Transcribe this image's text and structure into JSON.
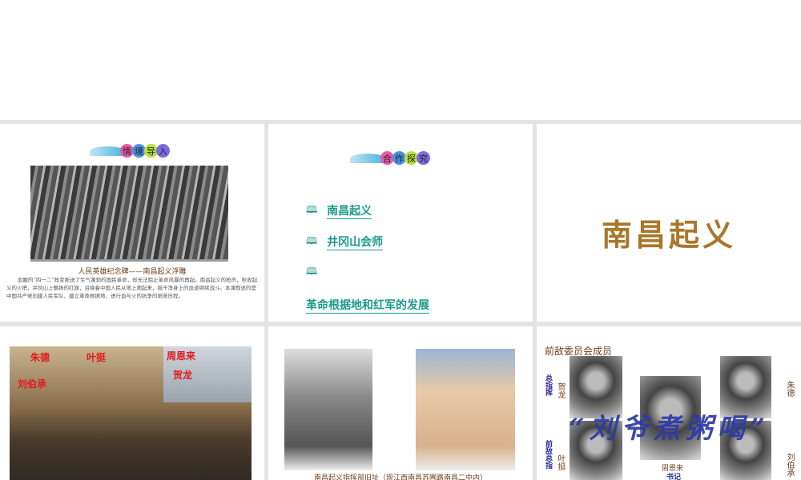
{
  "slides": [
    {
      "badge": [
        "情",
        "境",
        "导",
        "入"
      ],
      "badge_colors": [
        "#e85aa8",
        "#4a8fe0",
        "#b9e23a",
        "#7a6ae0"
      ],
      "caption": "人民英雄纪念碑——南昌起义浮雕",
      "paragraph": "血腥的“四一二”政变断送了生气蓬勃的国民革命，却无法阻止革命风暴的再起。南昌起义的枪声，秋收起义的火把，井冈山上飘扬的红旗，召唤着中国人民从地上爬起来，揩干净身上的血迹继续战斗。本课叙述的是中国共产党创建人民军队、建立革命根据地、进行血与火的抗争的艰苦历程。"
    },
    {
      "badge": [
        "合",
        "作",
        "探",
        "究"
      ],
      "badge_colors": [
        "#e85aa8",
        "#4a8fe0",
        "#b9e23a",
        "#7a6ae0"
      ],
      "items": [
        "南昌起义",
        "井冈山会师",
        "",
        "革命根据地和红军的发展"
      ]
    },
    {
      "title": "南昌起义"
    },
    {
      "labels": [
        "朱德",
        "叶挺",
        "周恩来",
        "刘伯承",
        "贺龙"
      ]
    },
    {
      "caption": "南昌起义指挥部旧址（现江西南昌苏圃路南昌二中内）"
    },
    {
      "heading": "前敌委员会成员",
      "names": [
        "贺龙",
        "叶挺",
        "周恩来",
        "朱德",
        "刘伯承"
      ],
      "roles": [
        "总指挥",
        "前敌总指",
        "书记"
      ],
      "slogan": "“刘爷煮粥喝”"
    }
  ]
}
